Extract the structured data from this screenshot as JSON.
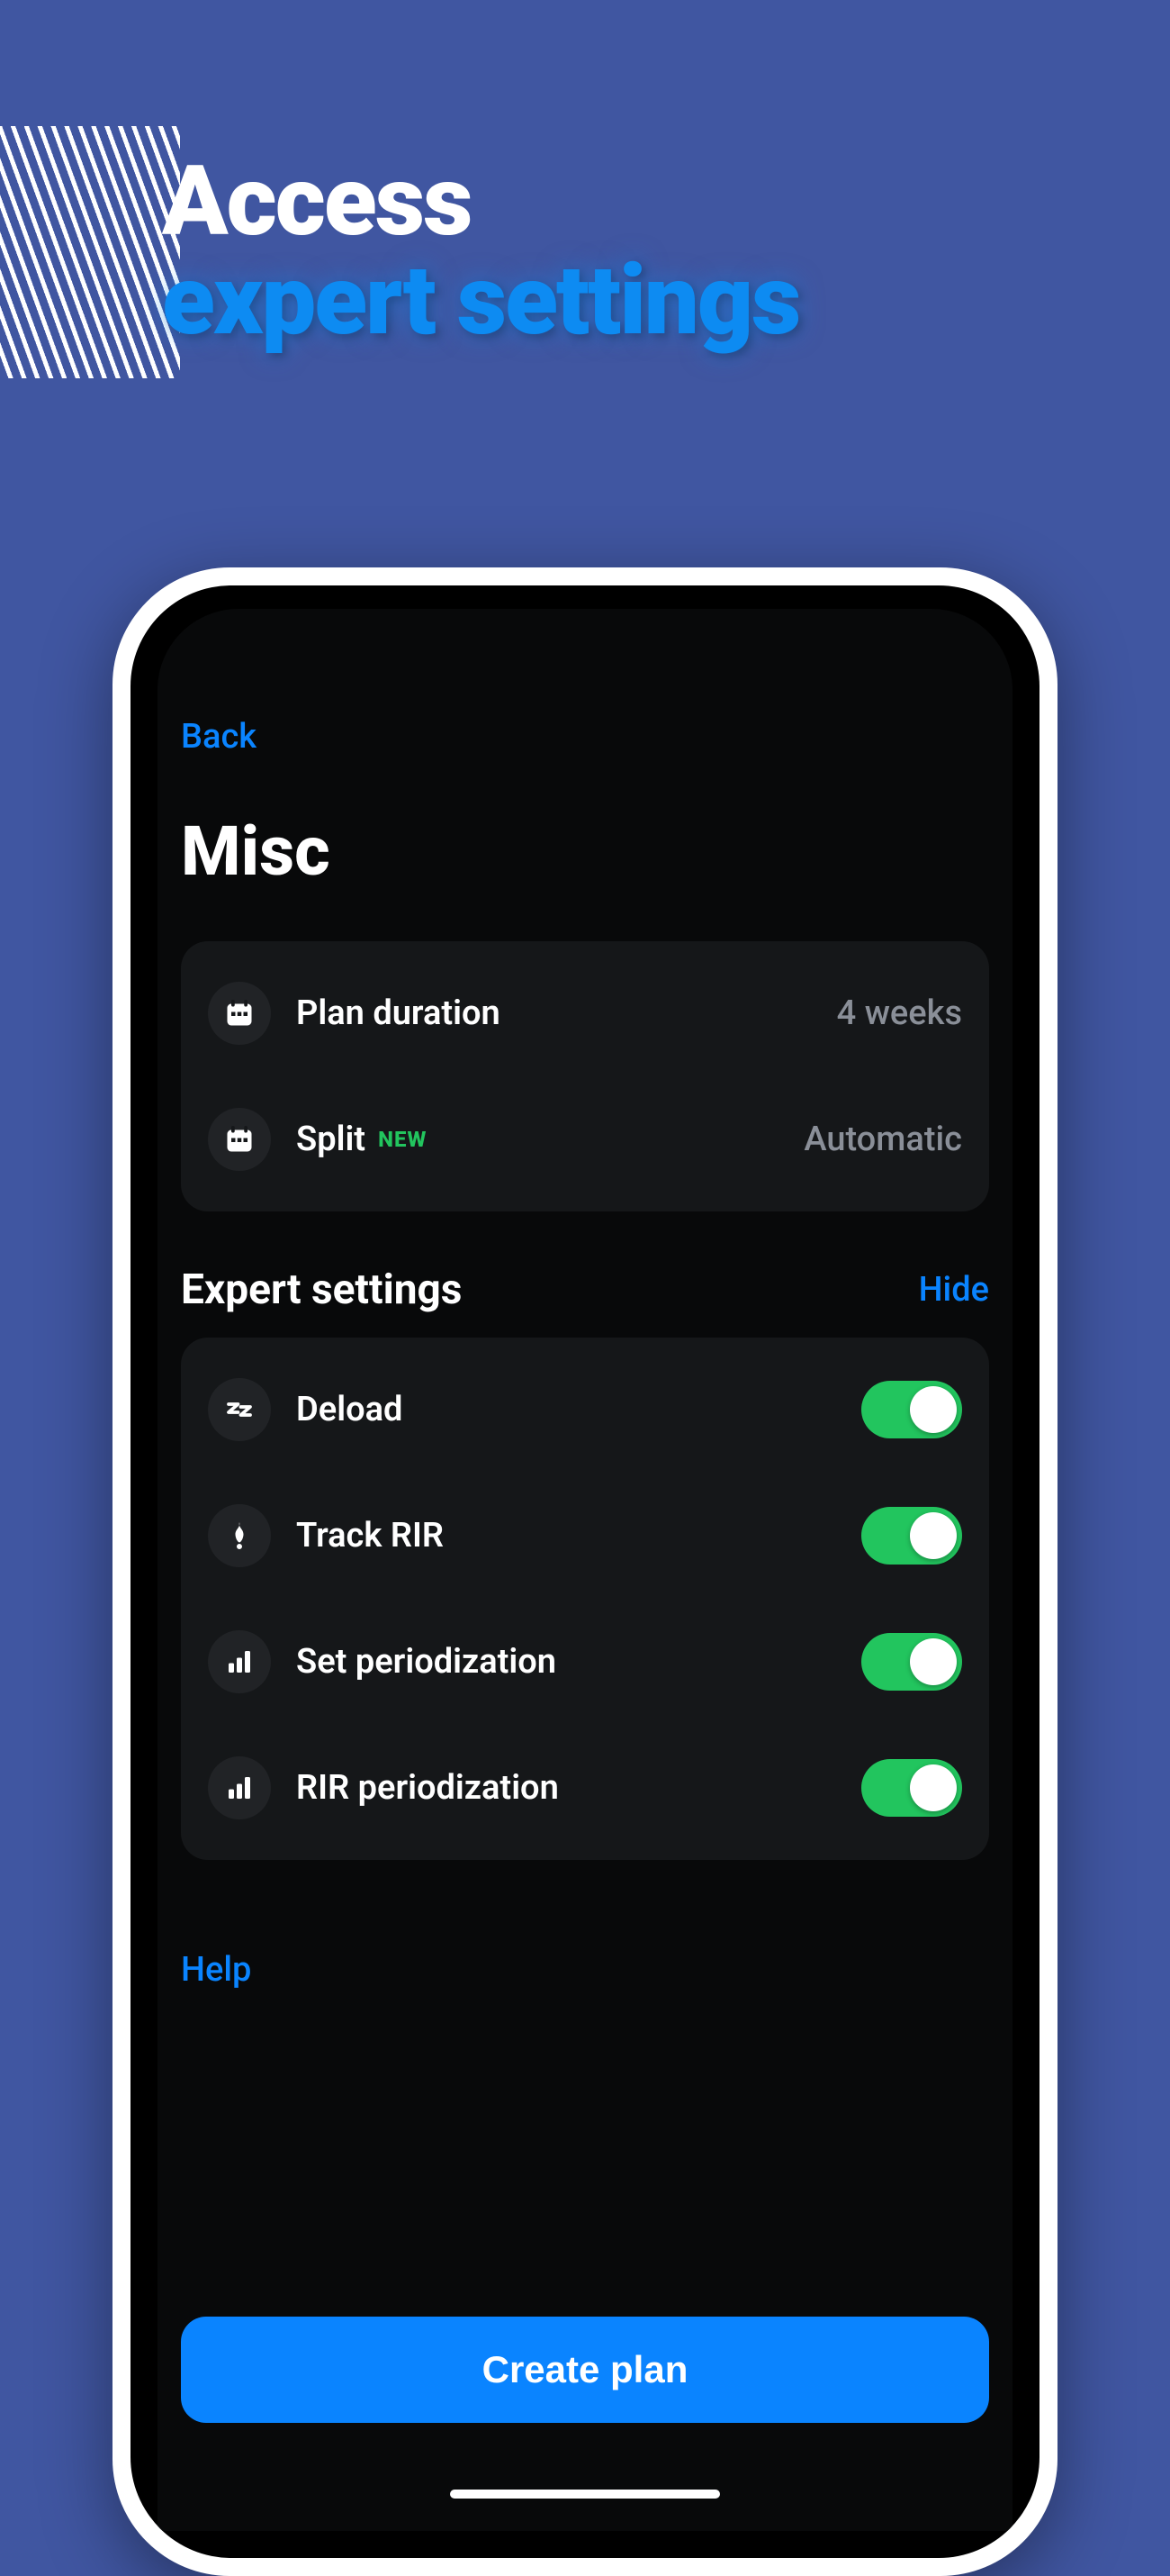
{
  "promo": {
    "line1": "Access",
    "line2": "expert settings"
  },
  "nav": {
    "back": "Back",
    "hide": "Hide",
    "help": "Help"
  },
  "page": {
    "title": "Misc",
    "expert_section_title": "Expert settings"
  },
  "misc": {
    "items": [
      {
        "label": "Plan duration",
        "value": "4 weeks",
        "icon": "calendar",
        "badge": ""
      },
      {
        "label": "Split",
        "value": "Automatic",
        "icon": "calendar",
        "badge": "NEW"
      }
    ]
  },
  "expert": {
    "items": [
      {
        "label": "Deload",
        "icon": "sleep",
        "on": true
      },
      {
        "label": "Track RIR",
        "icon": "flame",
        "on": true
      },
      {
        "label": "Set periodization",
        "icon": "bars",
        "on": true
      },
      {
        "label": "RIR periodization",
        "icon": "bars",
        "on": true
      }
    ]
  },
  "button": {
    "create_plan": "Create plan"
  }
}
